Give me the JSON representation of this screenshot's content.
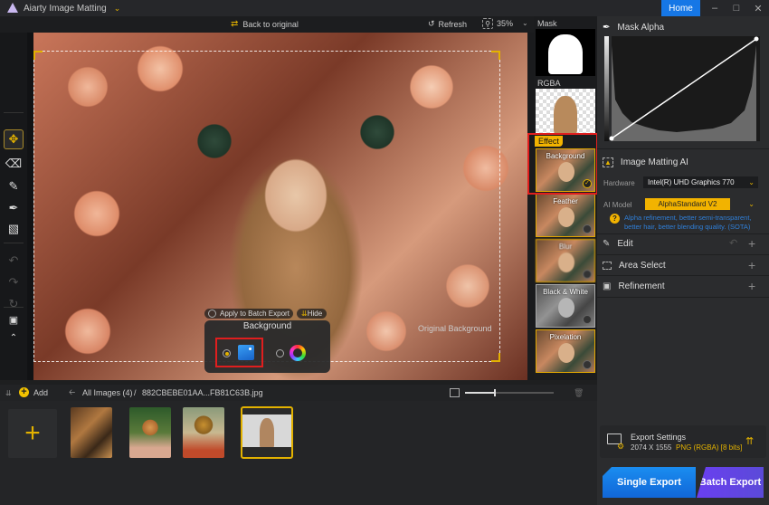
{
  "app": {
    "title": "Aiarty Image Matting",
    "home_label": "Home"
  },
  "window_controls": [
    "minimize",
    "maximize",
    "close"
  ],
  "topbar": {
    "back_to_original": "Back to original",
    "refresh": "Refresh",
    "zoom_level": "35%"
  },
  "toolbar": {
    "tools": [
      "move-tool",
      "eraser-tool",
      "brush-tool",
      "restore-brush-tool",
      "roller-tool",
      "undo",
      "redo",
      "reset",
      "fit-screen",
      "collapse"
    ]
  },
  "canvas": {
    "overlay_text": "Original Background",
    "bg_panel": {
      "apply_to_batch": "Apply to Batch Export",
      "hide": "Hide",
      "title": "Background",
      "selected_option": "image"
    }
  },
  "mask_column": {
    "mask_label": "Mask",
    "rgba_label": "RGBA",
    "effect_tag": "Effect",
    "effects": [
      {
        "label": "Background",
        "selected": true
      },
      {
        "label": "Feather",
        "selected": false
      },
      {
        "label": "Blur",
        "selected": false
      },
      {
        "label": "Black & White",
        "selected": false
      },
      {
        "label": "Pixelation",
        "selected": false
      }
    ]
  },
  "right_panel": {
    "mask_alpha": "Mask Alpha",
    "matting": {
      "title": "Image Matting AI",
      "hardware_label": "Hardware",
      "hardware_value": "Intel(R) UHD Graphics 770",
      "model_label": "AI Model",
      "model_value": "AlphaStandard  V2",
      "description": "Alpha refinement, better semi-transparent, better hair, better blending quality. (SOTA)"
    },
    "sections": [
      {
        "label": "Edit"
      },
      {
        "label": "Area Select"
      },
      {
        "label": "Refinement"
      }
    ],
    "export": {
      "title": "Export Settings",
      "dimensions": "2074 X 1555",
      "format": "PNG (RGBA) [8 bits]",
      "single_export": "Single Export",
      "batch_export": "Batch Export"
    }
  },
  "bottombar": {
    "add_label": "Add",
    "breadcrumb_root": "All Images (4)",
    "separator": "/",
    "filename": "882CBEBE01AA...FB81C63B.jpg",
    "thumb_size_fraction": 0.33
  },
  "filmstrip": {
    "items": [
      "workshop-scene",
      "lion-cub",
      "robot-helmet-girl",
      "woman-portrait"
    ],
    "selected_index": 3
  },
  "colors": {
    "accent": "#e3b200",
    "home_blue": "#1677e6",
    "single_export": "#1677e6",
    "batch_export": "#6a3ff0",
    "highlight_red": "#e01e1e",
    "desc_blue": "#2f7fd8"
  }
}
